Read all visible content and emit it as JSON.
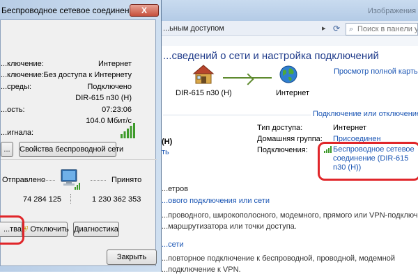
{
  "background_window": {
    "title": "Изображения",
    "breadcrumb": "...ьным доступом",
    "search_placeholder": "Поиск в панели упр",
    "main_title": "...сведений о сети и настройка подключений",
    "full_map_link": "Просмотр полной карты",
    "map": {
      "router_label": "DIR-615 n30 (H)",
      "internet_label": "Интернет"
    },
    "connect_disconnect_link": "Подключение или отключение",
    "network": {
      "name": "(H)",
      "type": "ть"
    },
    "info": {
      "access_type_label": "Тип доступа:",
      "access_type_value": "Интернет",
      "homegroup_label": "Домашняя группа:",
      "homegroup_value": "Присоединен",
      "connections_label": "Подключения:",
      "connection_link": "Беспроводное сетевое соединение (DIR-615 n30 (H))"
    },
    "change_settings": {
      "heading": "...етров",
      "link1": "...ового подключения или сети",
      "desc1_line1": "...проводного, широкополосного, модемного, прямого или VPN-подключения",
      "desc1_line2": "...маршрутизатора или точки доступа.",
      "link2": "...сети",
      "desc2_line1": "...повторное подключение к беспроводной, проводной, модемной",
      "desc2_line2": "...подключение к VPN."
    }
  },
  "dialog": {
    "title": "Беспроводное сетевое соединение",
    "close_label": "X",
    "status_rows": [
      {
        "label": "...ключение:",
        "value": "Интернет"
      },
      {
        "label": "...ключение:",
        "value": "Без доступа к Интернету"
      },
      {
        "label": "...среды:",
        "value": "Подключено"
      },
      {
        "label": "",
        "value": "DIR-615 n30 (H)"
      },
      {
        "label": "...ость:",
        "value": "07:23:06"
      },
      {
        "label": "",
        "value": "104.0 Мбит/с"
      },
      {
        "label": "...игнала:",
        "value": ""
      }
    ],
    "signal_bars": 5,
    "details_button": "...",
    "wireless_props_button": "Свойства беспроводной сети",
    "activity": {
      "sent_label": "Отправлено",
      "received_label": "Принято",
      "sent_value": "74 284 125",
      "received_value": "1 230 362 353"
    },
    "properties_button": "...тва",
    "disconnect_button": "Отключить",
    "diagnostics_button": "Диагностика",
    "close_button": "Закрыть"
  }
}
